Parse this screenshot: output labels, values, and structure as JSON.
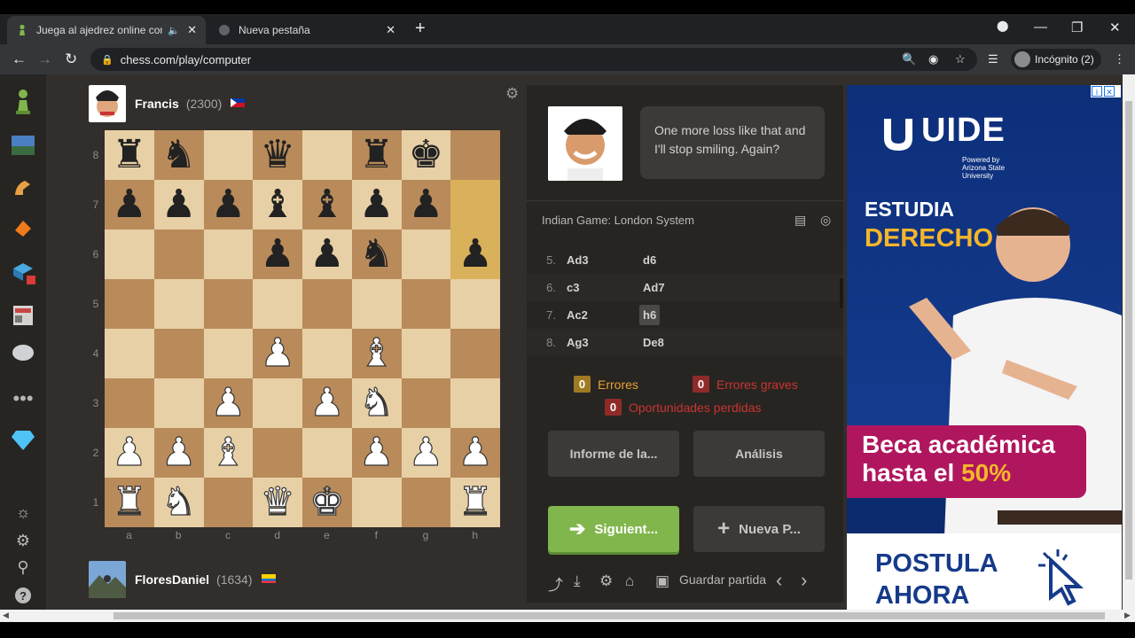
{
  "browser": {
    "tabs": [
      {
        "title": "Juega al ajedrez online contr",
        "active": true
      },
      {
        "title": "Nueva pestaña",
        "active": false
      }
    ],
    "url": "chess.com/play/computer",
    "incognito_label": "Incógnito (2)"
  },
  "players": {
    "top": {
      "name": "Francis",
      "rating": "(2300)"
    },
    "bottom": {
      "name": "FloresDaniel",
      "rating": "(1634)"
    }
  },
  "board": {
    "ranks": [
      "8",
      "7",
      "6",
      "5",
      "4",
      "3",
      "2",
      "1"
    ],
    "files": [
      "a",
      "b",
      "c",
      "d",
      "e",
      "f",
      "g",
      "h"
    ],
    "position": [
      [
        "br",
        "bn",
        "",
        "bq",
        "",
        "br",
        "bk",
        ""
      ],
      [
        "bp",
        "bp",
        "bp",
        "bb",
        "bb",
        "bp",
        "bp",
        ""
      ],
      [
        "",
        "",
        "",
        "bp",
        "bp",
        "bn",
        "",
        "bp"
      ],
      [
        "",
        "",
        "",
        "",
        "",
        "",
        "",
        ""
      ],
      [
        "",
        "",
        "",
        "wp",
        "",
        "wb",
        "",
        ""
      ],
      [
        "",
        "",
        "wp",
        "",
        "wp",
        "wn",
        "",
        ""
      ],
      [
        "wp",
        "wp",
        "wb",
        "",
        "",
        "wp",
        "wp",
        "wp"
      ],
      [
        "wr",
        "wn",
        "",
        "wq",
        "wk",
        "",
        "",
        "wr"
      ]
    ],
    "highlighted_squares": [
      "h7",
      "h6"
    ]
  },
  "coach": {
    "message": "One more loss like that and I'll stop smiling. Again?"
  },
  "opening": "Indian Game: London System",
  "moves": [
    {
      "num": "5.",
      "white": "Ad3",
      "black": "d6"
    },
    {
      "num": "6.",
      "white": "c3",
      "black": "Ad7"
    },
    {
      "num": "7.",
      "white": "Ac2",
      "black": "h6"
    },
    {
      "num": "8.",
      "white": "Ag3",
      "black": "De8"
    }
  ],
  "stats": {
    "errors": {
      "count": "0",
      "label": "Errores"
    },
    "blunders": {
      "count": "0",
      "label": "Errores graves"
    },
    "missed": {
      "count": "0",
      "label": "Oportunidades perdidas"
    }
  },
  "buttons": {
    "report": "Informe de la...",
    "analysis": "Análisis",
    "next": "Siguient...",
    "new_game": "Nueva P..."
  },
  "bottom_bar": {
    "save_label": "Guardar partida"
  },
  "ad": {
    "brand": "UIDE",
    "powered": "Powered by Arizona State University",
    "line1": "ESTUDIA",
    "line2": "DERECHO",
    "beca1": "Beca académica",
    "beca2": "hasta el ",
    "beca_pct": "50%",
    "cta1": "POSTULA",
    "cta2": "AHORA"
  },
  "colors": {
    "accent_green": "#81b64c",
    "error_yellow": "#e6a030",
    "blunder_red": "#ca3431",
    "board_light": "#e8d0a6",
    "board_dark": "#b98b5a"
  }
}
